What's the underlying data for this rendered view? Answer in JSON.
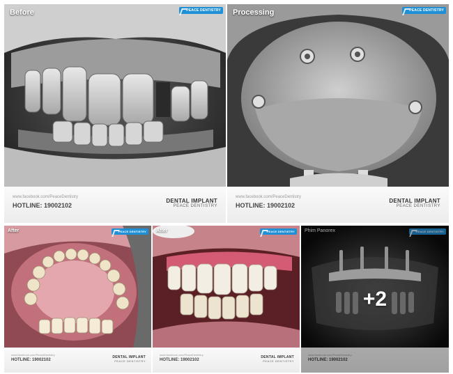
{
  "tiles": {
    "before": {
      "label": "Before",
      "badge": "PEACE DENTISTRY",
      "site": "www.facebook.com/PeaceDentistry",
      "hotline": "HOTLINE: 19002102",
      "brand_line1": "DENTAL IMPLANT",
      "brand_line2": "PEACE DENTISTRY"
    },
    "processing": {
      "label": "Processing",
      "badge": "PEACE DENTISTRY",
      "site": "www.facebook.com/PeaceDentistry",
      "hotline": "HOTLINE: 19002102",
      "brand_line1": "DENTAL IMPLANT",
      "brand_line2": "PEACE DENTISTRY"
    },
    "after1": {
      "label": "After",
      "badge": "PEACE DENTISTRY",
      "site": "www.facebook.com/PeaceDentistry",
      "hotline": "HOTLINE: 19002102",
      "brand_line1": "DENTAL IMPLANT",
      "brand_line2": "PEACE DENTISTRY"
    },
    "after2": {
      "label": "After",
      "badge": "PEACE DENTISTRY",
      "site": "www.facebook.com/PeaceDentistry",
      "hotline": "HOTLINE: 19002102",
      "brand_line1": "DENTAL IMPLANT",
      "brand_line2": "PEACE DENTISTRY"
    },
    "panorex": {
      "label": "Phim Panorex",
      "badge": "PEACE DENTISTRY",
      "site": "www.facebook.com/PeaceDentistry",
      "hotline": "HOTLINE: 19002102",
      "more_count": "+2"
    }
  },
  "colors": {
    "badge": "#1f8fd6",
    "text_dark": "#333333",
    "gum": "#c9727e",
    "xray_bg": "#111111"
  }
}
